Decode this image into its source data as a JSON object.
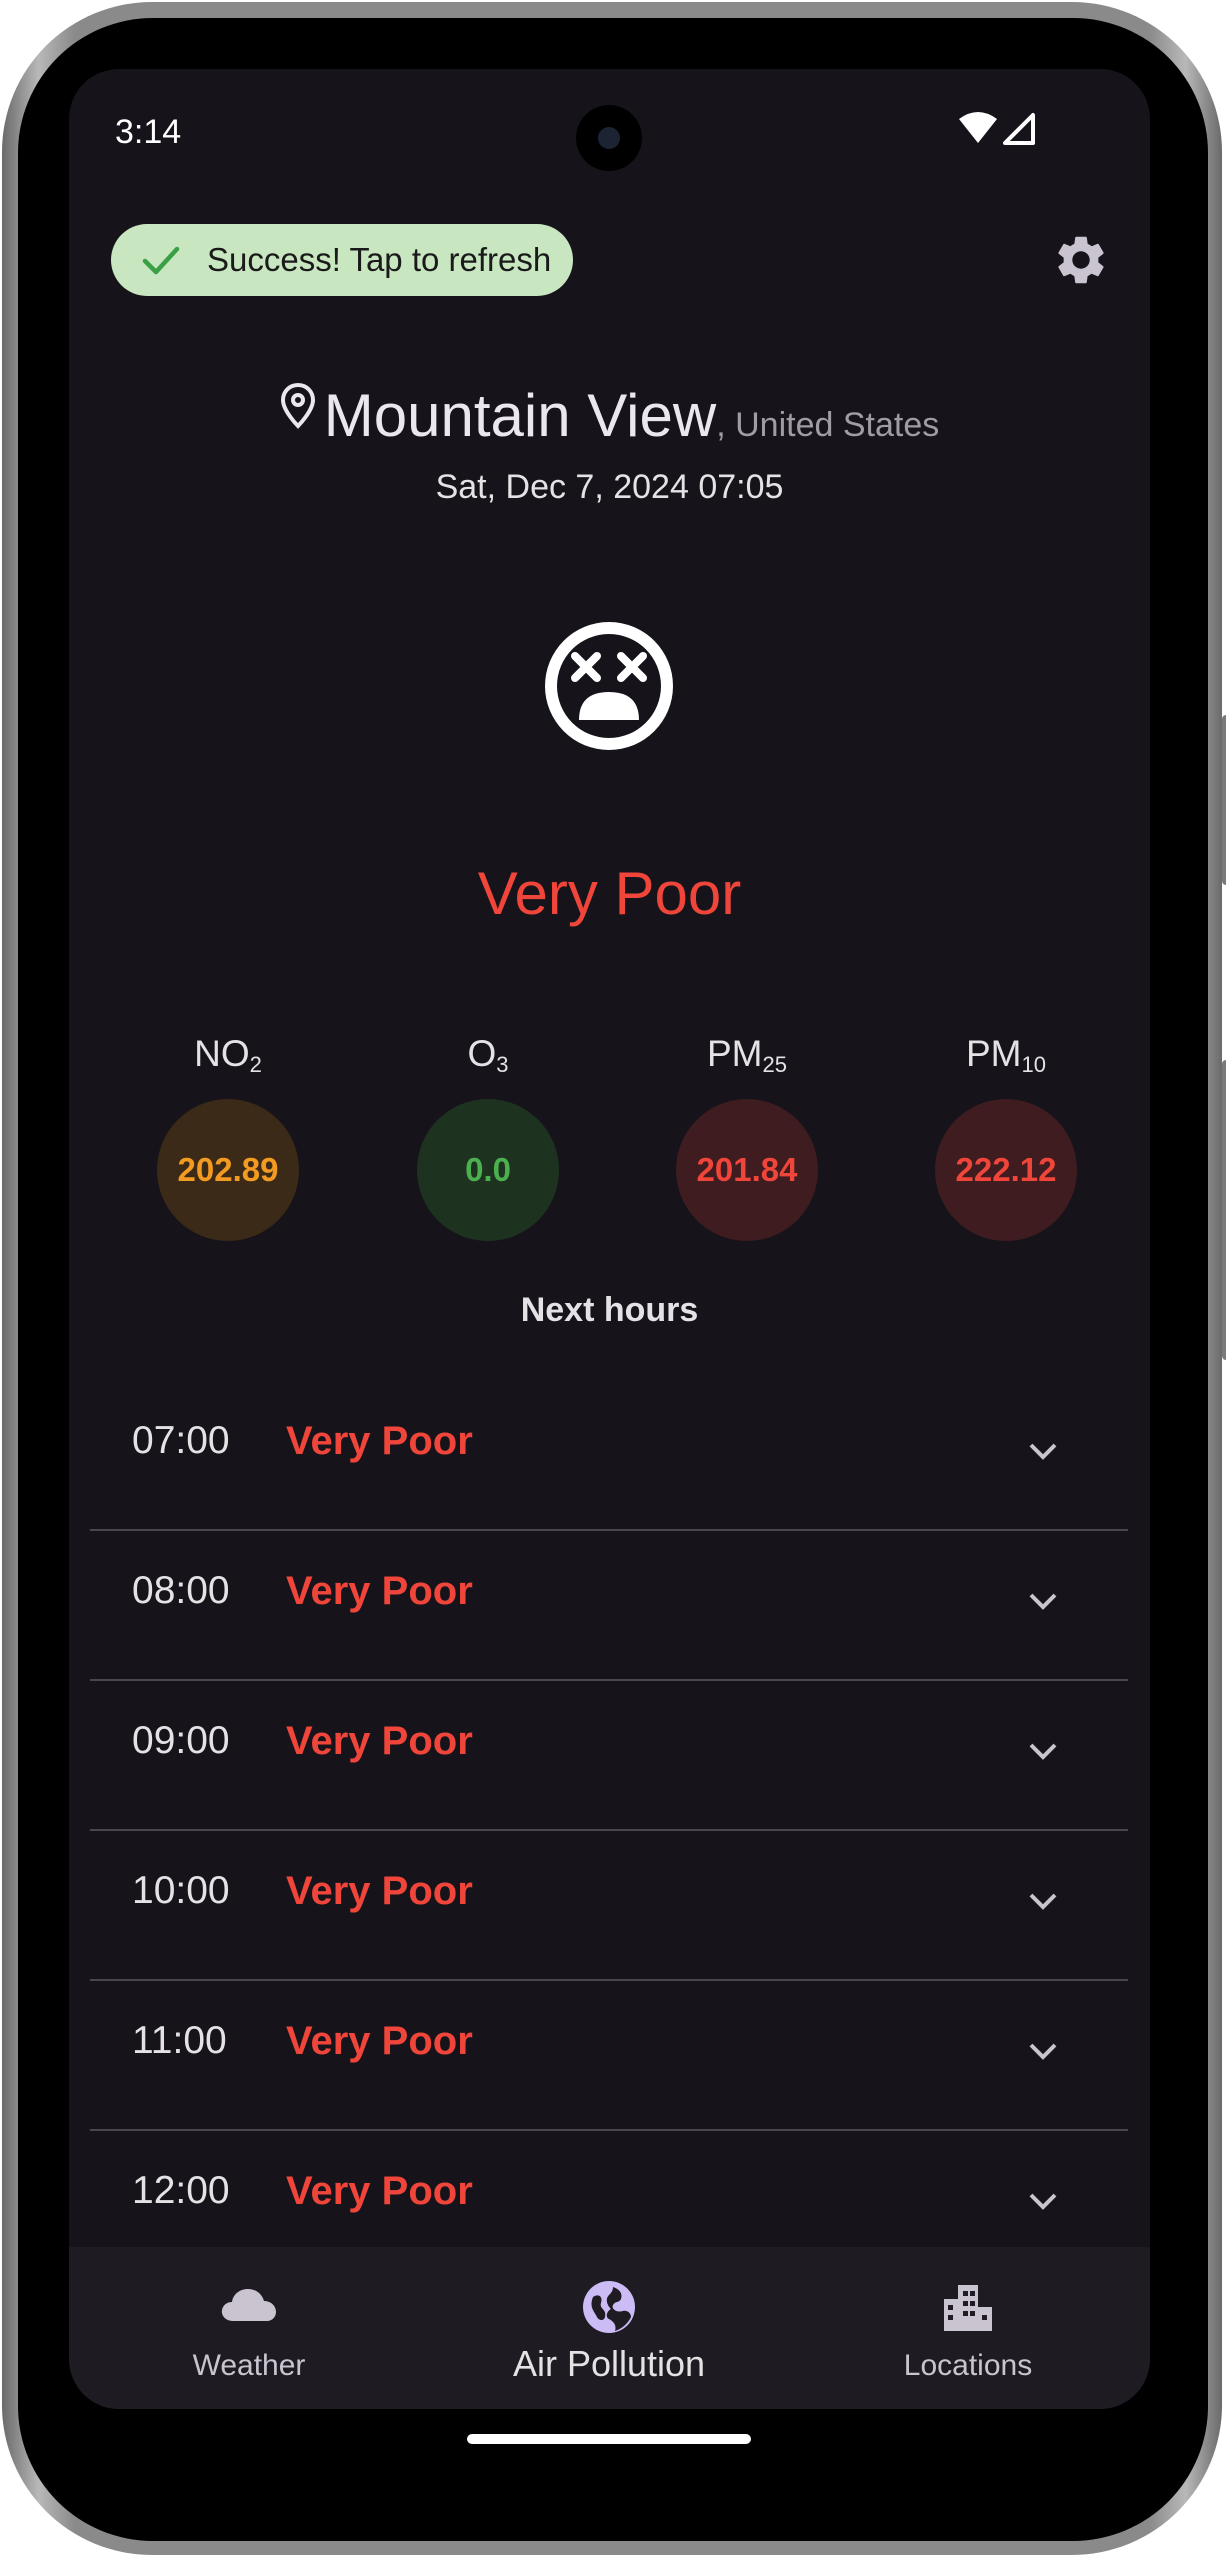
{
  "status_bar": {
    "time": "3:14"
  },
  "toast": {
    "label": "Success! Tap to refresh",
    "icon": "check-icon"
  },
  "header": {
    "city": "Mountain View",
    "country": ", United States",
    "datetime": "Sat, Dec 7, 2024 07:05"
  },
  "current": {
    "face_icon": "dizzy-face-icon",
    "quality": "Very Poor",
    "quality_color": "#f0453a"
  },
  "pollutants": [
    {
      "name": "NO",
      "sub": "2",
      "value": "202.89",
      "color": "#f29a21",
      "bg": "#3a2a17"
    },
    {
      "name": "O",
      "sub": "3",
      "value": "0.0",
      "color": "#4caf50",
      "bg": "#1d3320"
    },
    {
      "name": "PM",
      "sub": "25",
      "value": "201.84",
      "color": "#f0453a",
      "bg": "#3e1c1f"
    },
    {
      "name": "PM",
      "sub": "10",
      "value": "222.12",
      "color": "#f0453a",
      "bg": "#3e1c1f"
    }
  ],
  "next_hours": {
    "title": "Next hours",
    "rows": [
      {
        "time": "07:00",
        "quality": "Very Poor"
      },
      {
        "time": "08:00",
        "quality": "Very Poor"
      },
      {
        "time": "09:00",
        "quality": "Very Poor"
      },
      {
        "time": "10:00",
        "quality": "Very Poor"
      },
      {
        "time": "11:00",
        "quality": "Very Poor"
      },
      {
        "time": "12:00",
        "quality": "Very Poor"
      }
    ]
  },
  "bottom_nav": {
    "items": [
      {
        "label": "Weather",
        "icon": "cloud-icon",
        "selected": false
      },
      {
        "label": "Air Pollution",
        "icon": "globe-icon",
        "selected": true
      },
      {
        "label": "Locations",
        "icon": "city-icon",
        "selected": false
      }
    ]
  }
}
